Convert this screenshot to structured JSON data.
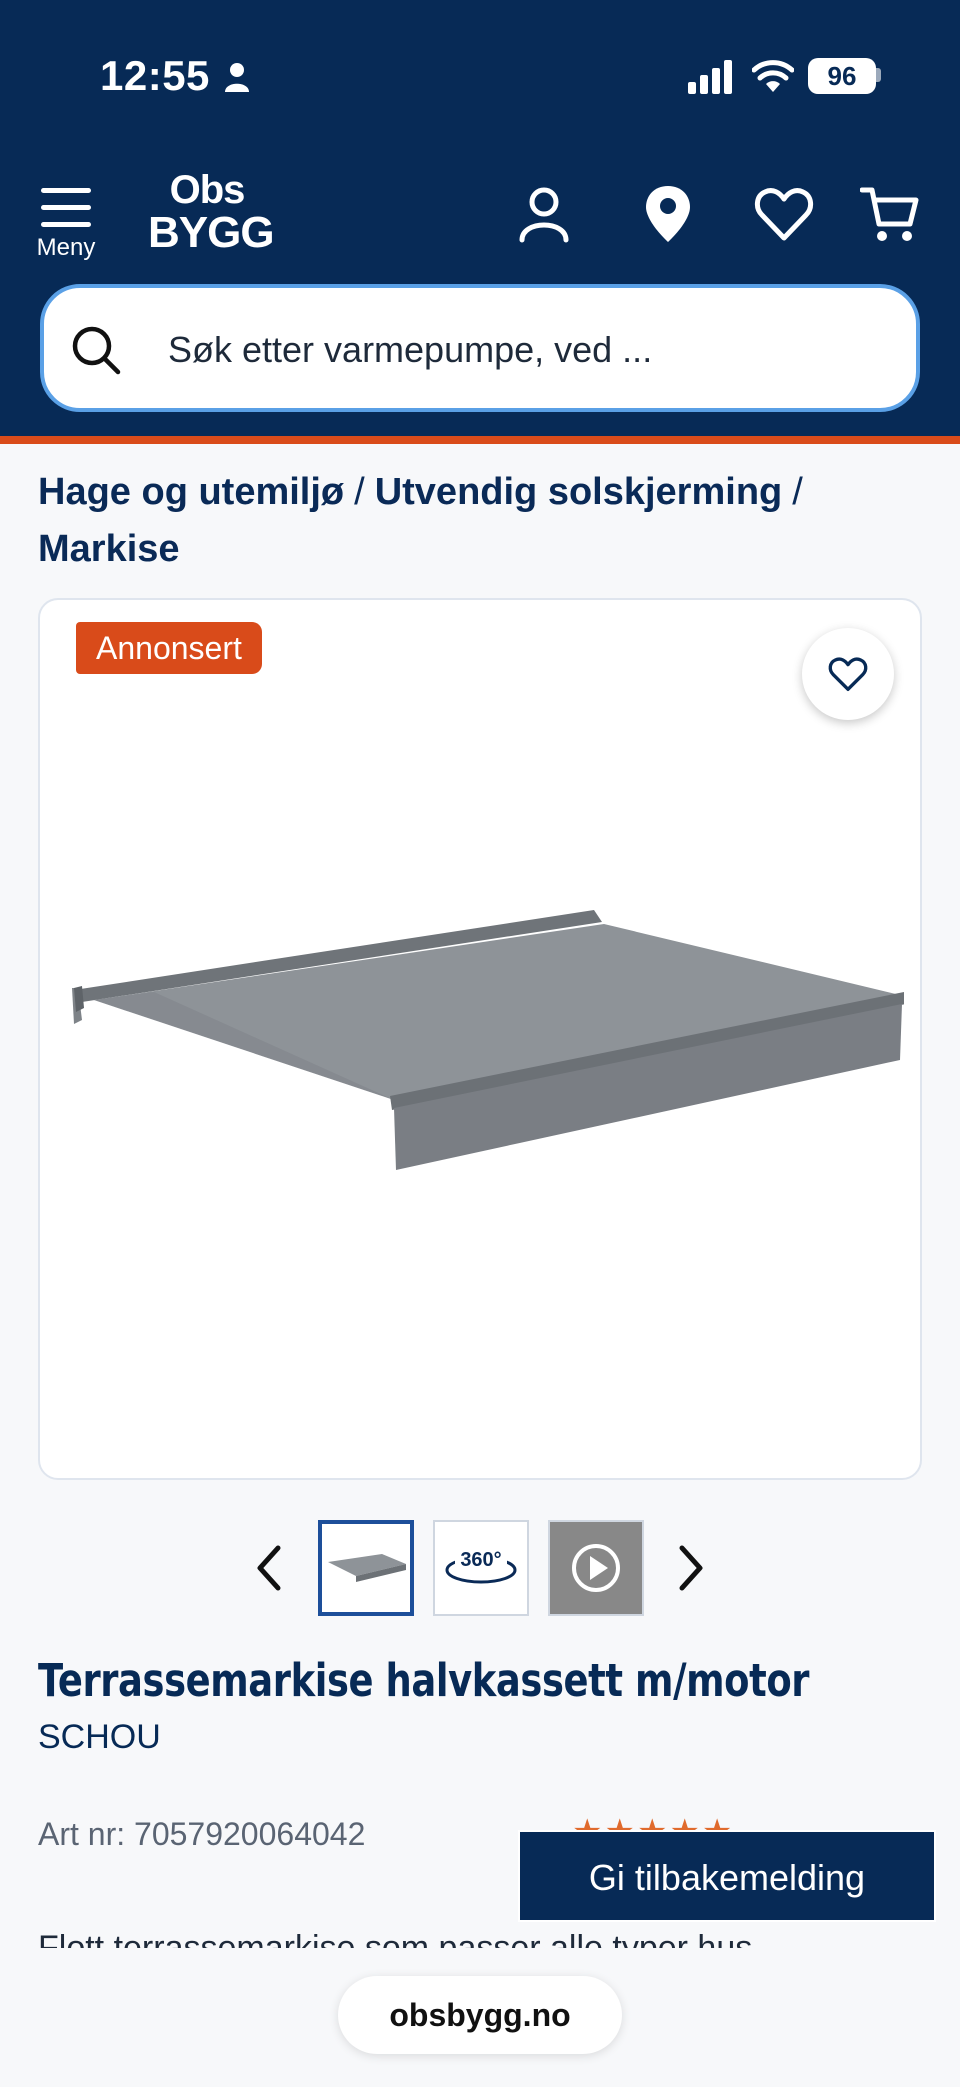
{
  "status_bar": {
    "time": "12:55",
    "battery": "96"
  },
  "header": {
    "menu_label": "Meny",
    "logo_line1": "Obs",
    "logo_line2": "BYGG",
    "icons": [
      "account-icon",
      "location-pin-icon",
      "heart-icon",
      "cart-icon"
    ]
  },
  "search": {
    "placeholder": "Søk etter varmepumpe, ved ..."
  },
  "breadcrumb": {
    "items": [
      "Hage og utemiljø",
      "Utvendig solskjerming",
      "Markise"
    ],
    "separator": "/"
  },
  "product": {
    "badge": "Annonsert",
    "title": "Terrassemarkise halvkassett m/motor",
    "brand": "SCHOU",
    "art_nr": "Art nr: 7057920064042",
    "thumbnail_360_label": "360°",
    "description": "Flott terrassemarkise som passer alle typer hus",
    "rating_stars": "★★★★★"
  },
  "feedback_button": "Gi tilbakemelding",
  "browser": {
    "url": "obsbygg.no"
  },
  "colors": {
    "header_bg": "#072a56",
    "accent": "#d94b1a",
    "search_border": "#5aa0e6"
  }
}
